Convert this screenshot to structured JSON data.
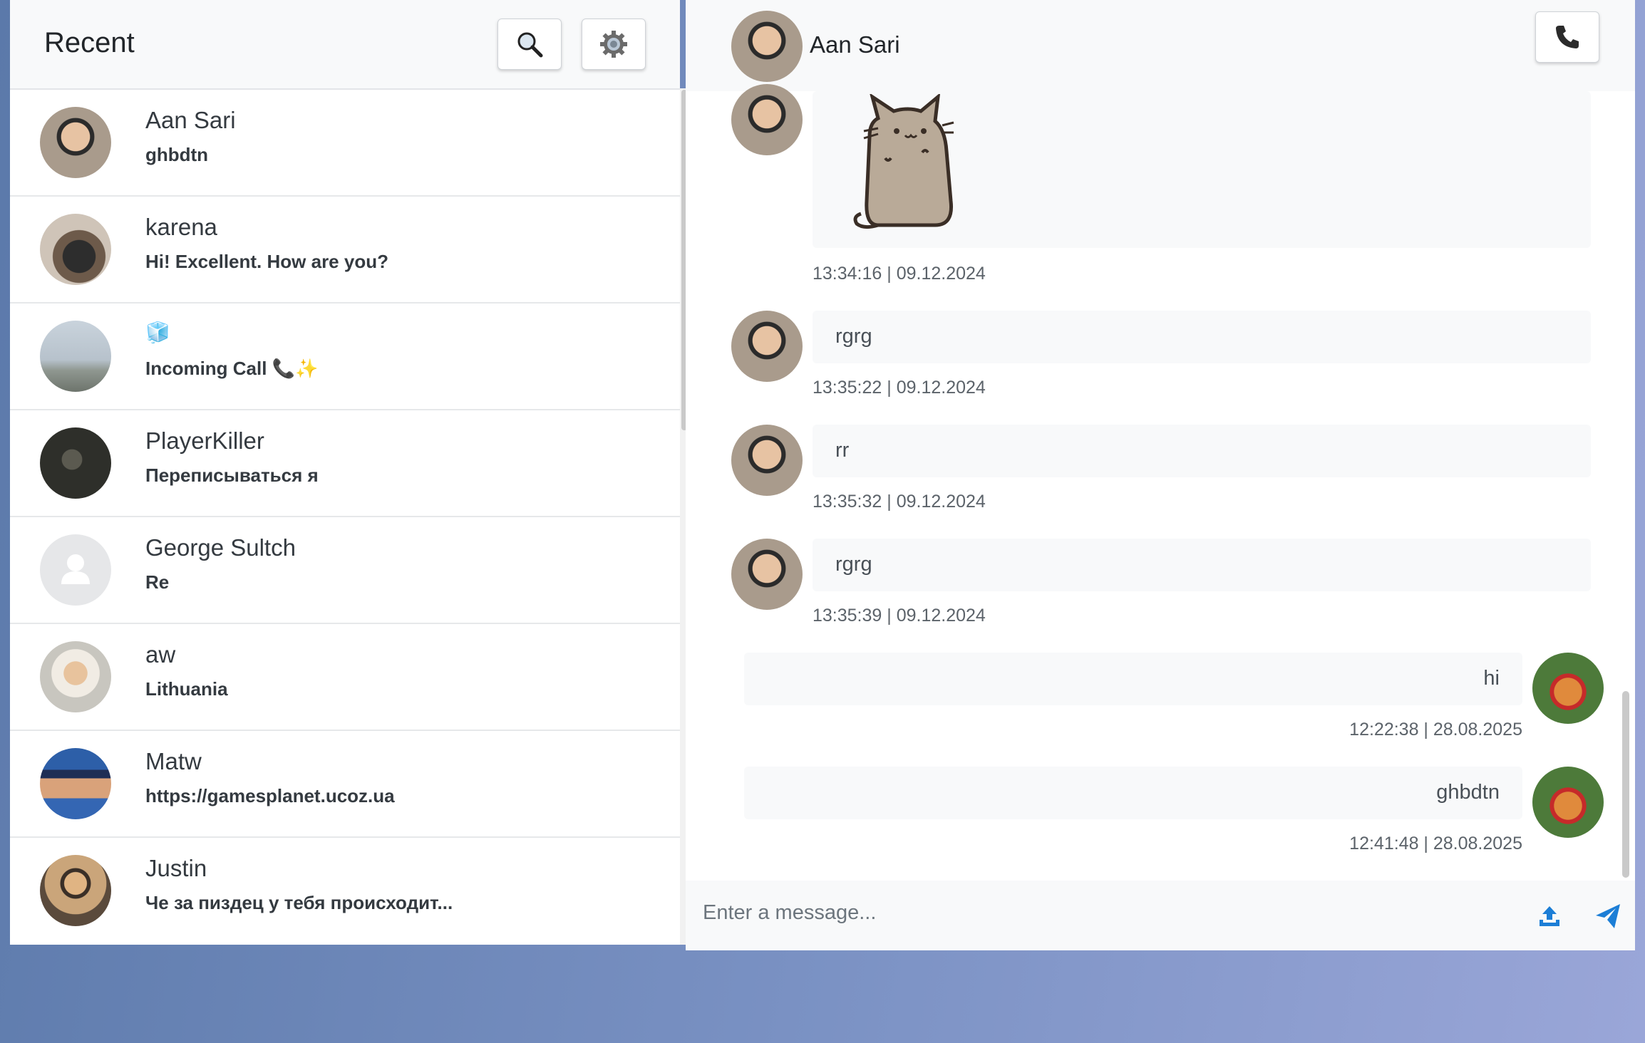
{
  "sidebar": {
    "title": "Recent",
    "search_icon": "search-icon",
    "settings_icon": "gear-icon",
    "contacts": [
      {
        "name": "Aan Sari",
        "last_message": "ghbdtn"
      },
      {
        "name": "karena",
        "last_message": "Hi! Excellent. How are you?"
      },
      {
        "name": "🧊",
        "last_message": "Incoming Call 📞✨"
      },
      {
        "name": "PlayerKiller",
        "last_message": "Переписываться я"
      },
      {
        "name": "George Sultch",
        "last_message": "Re"
      },
      {
        "name": "aw",
        "last_message": "Lithuania"
      },
      {
        "name": "Matw",
        "last_message": "https://gamesplanet.ucoz.ua"
      },
      {
        "name": "Justin",
        "last_message": "Че за пиздец у тебя происходит..."
      }
    ]
  },
  "chat": {
    "contact_name": "Aan Sari",
    "call_icon": "phone-icon",
    "messages": [
      {
        "direction": "in",
        "type": "sticker",
        "sticker": "pusheen-cat-sticker",
        "time": "13:34:16 | 09.12.2024"
      },
      {
        "direction": "in",
        "text": "rgrg",
        "time": "13:35:22 | 09.12.2024"
      },
      {
        "direction": "in",
        "text": "rr",
        "time": "13:35:32 | 09.12.2024"
      },
      {
        "direction": "in",
        "text": "rgrg",
        "time": "13:35:39 | 09.12.2024"
      },
      {
        "direction": "out",
        "text": "hi",
        "time": "12:22:38 | 28.08.2025"
      },
      {
        "direction": "out",
        "text": "ghbdtn",
        "time": "12:41:48 | 28.08.2025"
      }
    ],
    "composer": {
      "placeholder": "Enter a message...",
      "upload_icon": "upload-icon",
      "send_icon": "send-icon"
    }
  },
  "colors": {
    "accent": "#1c7ed6",
    "header_bg": "#f8f9fa",
    "bubble_bg": "#f8f9fa"
  }
}
